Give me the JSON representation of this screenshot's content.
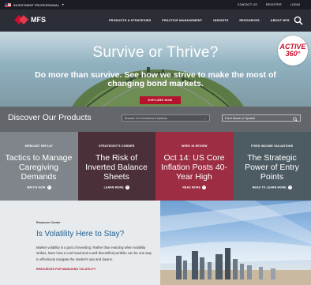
{
  "topbar": {
    "region_label": "INVESTMENT PROFESSIONAL",
    "contact": "CONTACT US",
    "register": "REGISTER",
    "login": "LOGIN"
  },
  "brand": {
    "name": "MFS"
  },
  "nav": {
    "items": [
      "PRODUCTS & STRATEGIES",
      "PRACTICE MANAGEMENT",
      "INSIGHTS",
      "RESOURCES",
      "ABOUT MFS"
    ]
  },
  "hero": {
    "title": "Survive or Thrive?",
    "subtitle": "Do more than survive. See how we strive to make the most of changing bond markets.",
    "cta": "EXPLORE NOW",
    "badge_line1": "ACTIVE",
    "badge_line2": "360°"
  },
  "discover": {
    "title": "Discover Our Products",
    "select_value": "Browse Our Investment Options",
    "search_placeholder": "Fund Name or Symbol"
  },
  "cards": [
    {
      "kicker": "WEBCAST REPLAY",
      "headline": "Tactics to Manage Caregiving Demands",
      "more": "WATCH NOW"
    },
    {
      "kicker": "STRATEGIST'S CORNER",
      "headline": "The Risk of Inverted Balance Sheets",
      "more": "LEARN MORE"
    },
    {
      "kicker": "WEEK IN REVIEW",
      "headline": "Oct 14: US Core Inflation Posts 40-Year High",
      "more": "READ MORE"
    },
    {
      "kicker": "FIXED INCOME VALUATIONS",
      "headline": "The Strategic Power of Entry Points",
      "more": "READ TO LEARN MORE"
    }
  ],
  "resource": {
    "kicker": "Resource Center",
    "title": "Is Volatility Here to Stay?",
    "body": "Market volatility is a part of investing. Rather than reacting when volatility strikes, learn how a cool head and a well-diversified portfolio can be one way to effectively navigate the market's ups and downs.",
    "link": "RESOURCES FOR MANAGING VOLATILITY"
  },
  "colors": {
    "brand_red": "#b5122d",
    "nav_bg": "#2b2e37",
    "link_blue": "#1f5d8d"
  },
  "icons": [
    "us-flag-icon",
    "caret-down-icon",
    "mfs-logo-icon",
    "search-icon",
    "chevron-down-icon",
    "arrow-right-icon"
  ]
}
